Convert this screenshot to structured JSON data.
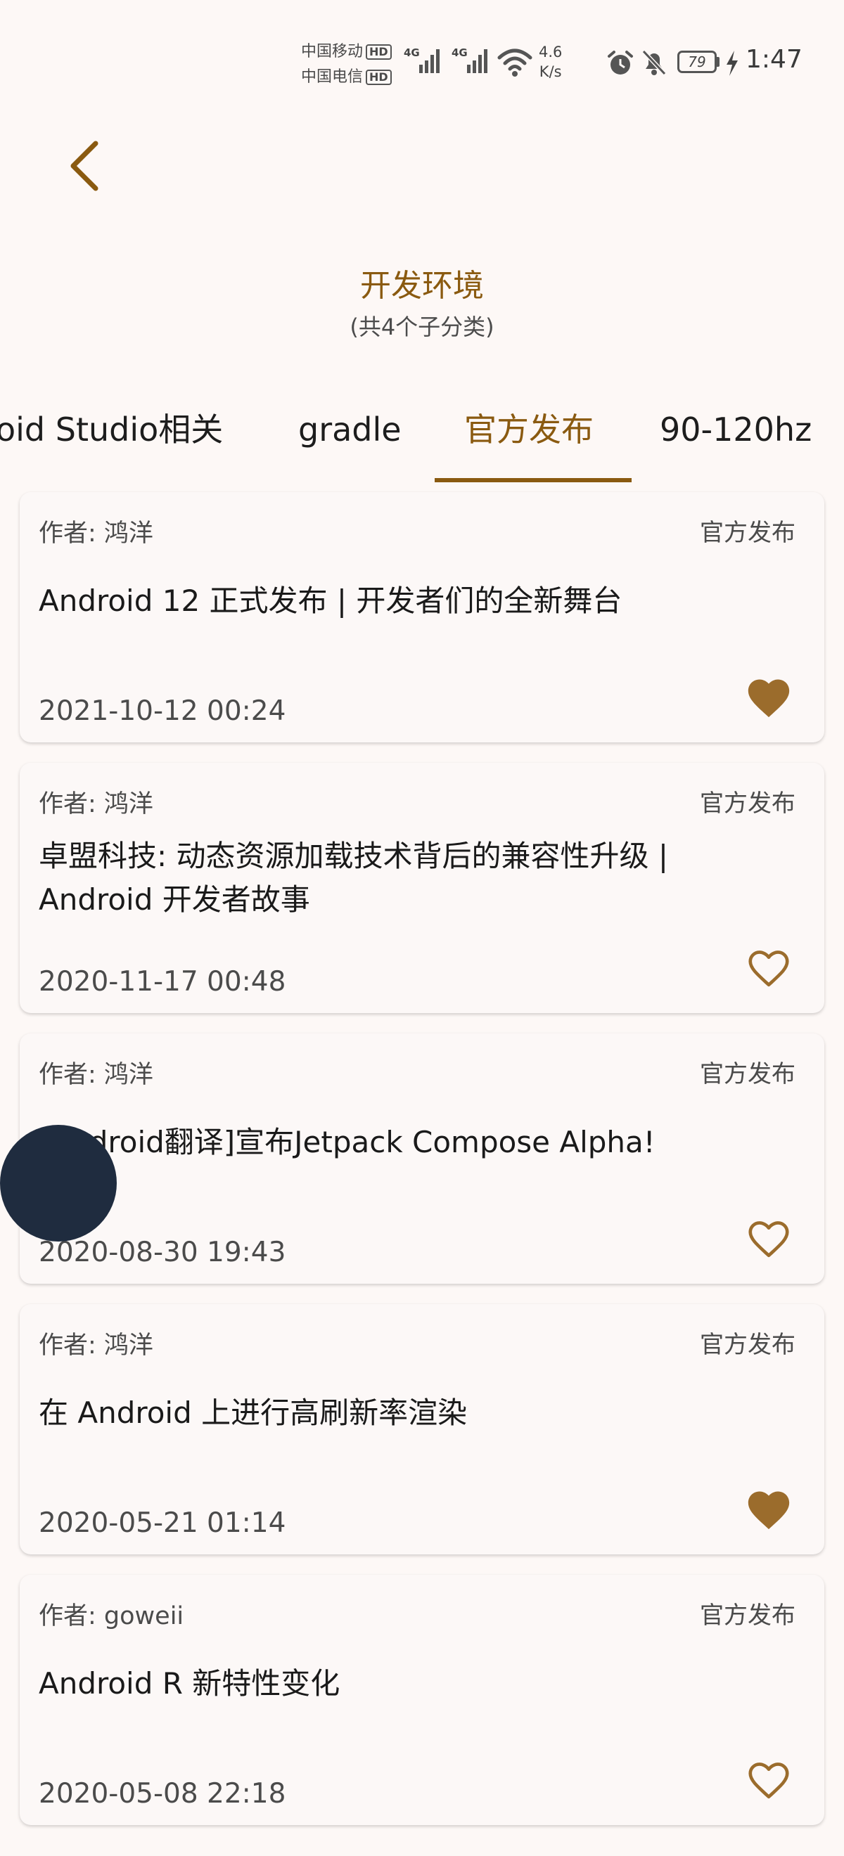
{
  "status_bar": {
    "carrier1": "中国移动",
    "carrier2": "中国电信",
    "hd_badge": "HD",
    "network_type": "4G",
    "speed_value": "4.6",
    "speed_unit": "K/s",
    "battery": "79",
    "time": "1:47"
  },
  "header": {
    "title": "开发环境",
    "subtitle": "(共4个子分类)"
  },
  "tabs": [
    {
      "label": "oid Studio相关",
      "active": false
    },
    {
      "label": "gradle",
      "active": false
    },
    {
      "label": "官方发布",
      "active": true
    },
    {
      "label": "90-120hz",
      "active": false
    }
  ],
  "articles": [
    {
      "author": "作者: 鸿洋",
      "category": "官方发布",
      "title": "Android 12 正式发布 | 开发者们的全新舞台",
      "date": "2021-10-12 00:24",
      "favorited": true
    },
    {
      "author": "作者: 鸿洋",
      "category": "官方发布",
      "title": "卓盟科技: 动态资源加载技术背后的兼容性升级 | Android 开发者故事",
      "date": "2020-11-17 00:48",
      "favorited": false
    },
    {
      "author": "作者: 鸿洋",
      "category": "官方发布",
      "title": "[Android翻译]宣布Jetpack Compose Alpha!",
      "date": "2020-08-30 19:43",
      "favorited": false
    },
    {
      "author": "作者: 鸿洋",
      "category": "官方发布",
      "title": "在 Android 上进行高刷新率渲染",
      "date": "2020-05-21 01:14",
      "favorited": true
    },
    {
      "author": "作者: goweii",
      "category": "官方发布",
      "title": "Android R 新特性变化",
      "date": "2020-05-08 22:18",
      "favorited": false
    }
  ],
  "colors": {
    "accent": "#8a5a10",
    "heart": "#9b6c2c",
    "background": "#fdf8f6",
    "float_ball": "#1f2c3f"
  }
}
